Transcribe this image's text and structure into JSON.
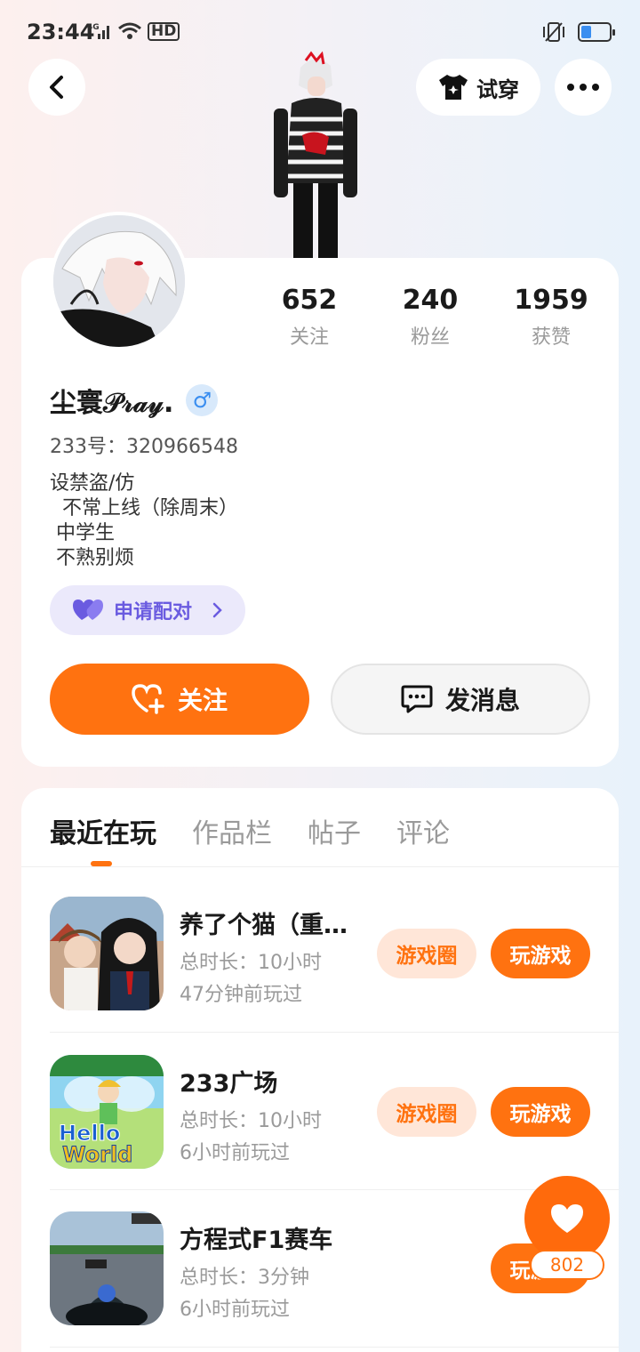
{
  "status_bar": {
    "time": "23:44",
    "network": "4G",
    "hd": "HD"
  },
  "header": {
    "tryon_label": "试穿"
  },
  "stats": [
    {
      "value": "652",
      "label": "关注"
    },
    {
      "value": "240",
      "label": "粉丝"
    },
    {
      "value": "1959",
      "label": "获赞"
    }
  ],
  "profile": {
    "username": "尘寰𝒫𝓇𝒶𝓎.",
    "gender": "♂",
    "user_id": "233号：320966548",
    "bio": "设禁盗/仿\n  不常上线（除周末）\n 中学生\n 不熟别烦",
    "pair_label": "申请配对",
    "follow_label": "关注",
    "message_label": "发消息"
  },
  "tabs": [
    {
      "label": "最近在玩",
      "active": true
    },
    {
      "label": "作品栏",
      "active": false
    },
    {
      "label": "帖子",
      "active": false
    },
    {
      "label": "评论",
      "active": false
    }
  ],
  "games": [
    {
      "title": "养了个猫（重生之我是猫）",
      "duration": "总时长：10小时",
      "last_played": "47分钟前玩过",
      "circle_label": "游戏圈",
      "play_label": "玩游戏"
    },
    {
      "title": "233广场",
      "duration": "总时长：10小时",
      "last_played": "6小时前玩过",
      "circle_label": "游戏圈",
      "play_label": "玩游戏"
    },
    {
      "title": "方程式F1赛车",
      "duration": "总时长：3分钟",
      "last_played": "6小时前玩过",
      "circle_label": "",
      "play_label": "玩游戏"
    }
  ],
  "like_fab": {
    "count": "802"
  },
  "colors": {
    "accent": "#ff7210",
    "pair": "#6a5be0",
    "gender": "#3a8ef0"
  },
  "battery_level": 0.35
}
